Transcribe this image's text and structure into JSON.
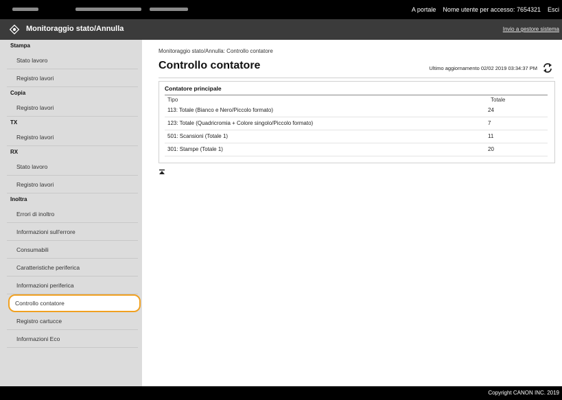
{
  "topbar": {
    "portal_link": "A portale",
    "user_label": "Nome utente per accesso:",
    "user_value": "7654321",
    "logout": "Esci"
  },
  "header": {
    "title": "Monitoraggio stato/Annulla",
    "send_link": "Invio a gestore sistema"
  },
  "sidebar": {
    "sections": [
      {
        "title": "Stampa",
        "items": [
          "Stato lavoro",
          "Registro lavori"
        ]
      },
      {
        "title": "Copia",
        "items": [
          "Registro lavori"
        ]
      },
      {
        "title": "TX",
        "items": [
          "Registro lavori"
        ]
      },
      {
        "title": "RX",
        "items": [
          "Stato lavoro",
          "Registro lavori"
        ]
      },
      {
        "title": "Inoltra",
        "items": [
          "Errori di inoltro"
        ]
      }
    ],
    "extra_items": [
      "Informazioni sull'errore",
      "Consumabili",
      "Caratteristiche periferica",
      "Informazioni periferica",
      "Controllo contatore",
      "Registro cartucce",
      "Informazioni Eco"
    ],
    "selected": "Controllo contatore"
  },
  "main": {
    "breadcrumb": "Monitoraggio stato/Annulla: Controllo contatore",
    "title": "Controllo contatore",
    "updated": "Ultimo aggiornamento 02/02 2019 03:34:37 PM",
    "panel": {
      "title": "Contatore principale",
      "col_type": "Tipo",
      "col_total": "Totale",
      "rows": [
        {
          "name": "113: Totale (Bianco e Nero/Piccolo formato)",
          "value": "24"
        },
        {
          "name": "123: Totale (Quadricromia + Colore singolo/Piccolo formato)",
          "value": "7"
        },
        {
          "name": "501: Scansioni (Totale 1)",
          "value": "11"
        },
        {
          "name": "301: Stampe (Totale 1)",
          "value": "20"
        }
      ]
    }
  },
  "footer": {
    "copyright": "Copyright CANON INC. 2019"
  },
  "colors": {
    "selected_outline": "#f0a020",
    "sidebar_bg": "#dcdcdc",
    "title_bar": "#3b3b3b"
  }
}
